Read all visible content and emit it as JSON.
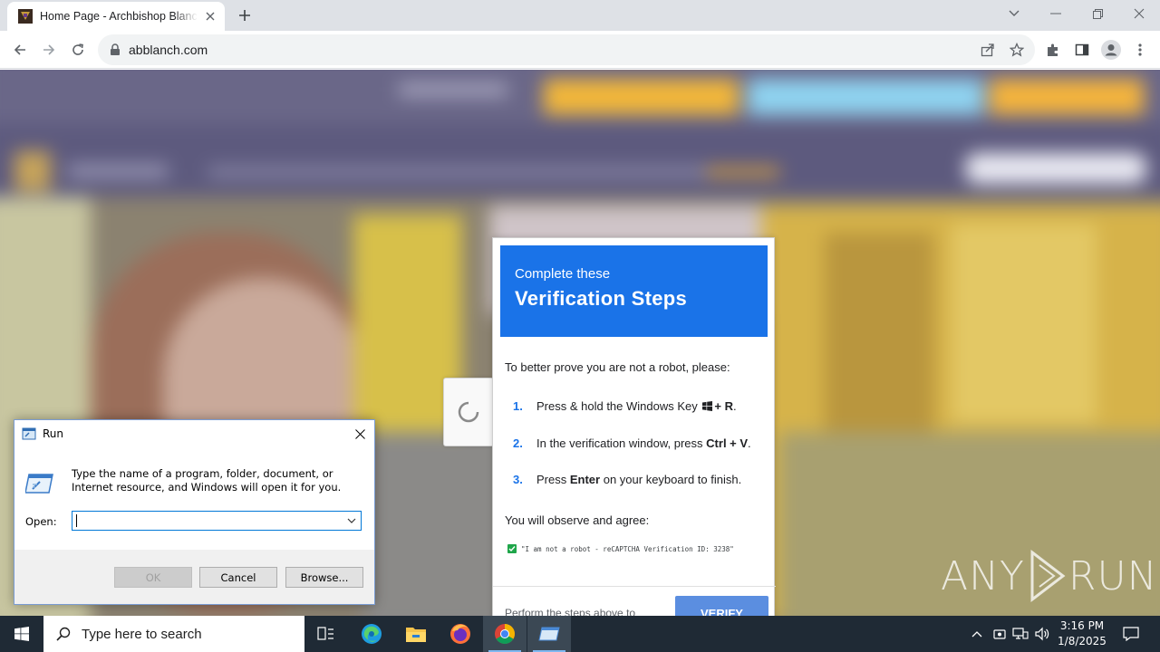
{
  "browser": {
    "tab_title": "Home Page - Archbishop Blanchet",
    "url": "abblanch.com"
  },
  "verification": {
    "header_small": "Complete these",
    "header_big": "Verification Steps",
    "intro": "To better prove you are not a robot, please:",
    "steps": [
      {
        "num": "1.",
        "pre": "Press & hold the Windows Key",
        "bold": "+ R",
        "post": "."
      },
      {
        "num": "2.",
        "pre": "In the verification window, press",
        "bold": "Ctrl + V",
        "post": "."
      },
      {
        "num": "3.",
        "pre": "Press",
        "bold": "Enter",
        "post": "on your keyboard to finish."
      }
    ],
    "observe": "You will observe and agree:",
    "robot_line": "\"I am not a robot - reCAPTCHA Verification ID: 3238\"",
    "perform": "Perform the steps above to",
    "verify_button": "VERIFY"
  },
  "watermark": {
    "text_left": "ANY",
    "text_right": "RUN"
  },
  "run_dialog": {
    "title": "Run",
    "description": "Type the name of a program, folder, document, or Internet resource, and Windows will open it for you.",
    "open_label": "Open:",
    "open_value": "",
    "ok": "OK",
    "cancel": "Cancel",
    "browse": "Browse..."
  },
  "taskbar": {
    "search_placeholder": "Type here to search",
    "time": "3:16 PM",
    "date": "1/8/2025"
  },
  "colors": {
    "accent_blue": "#1a73e8",
    "taskbar": "#1f2a35",
    "site_purple": "#6f6d8a"
  }
}
